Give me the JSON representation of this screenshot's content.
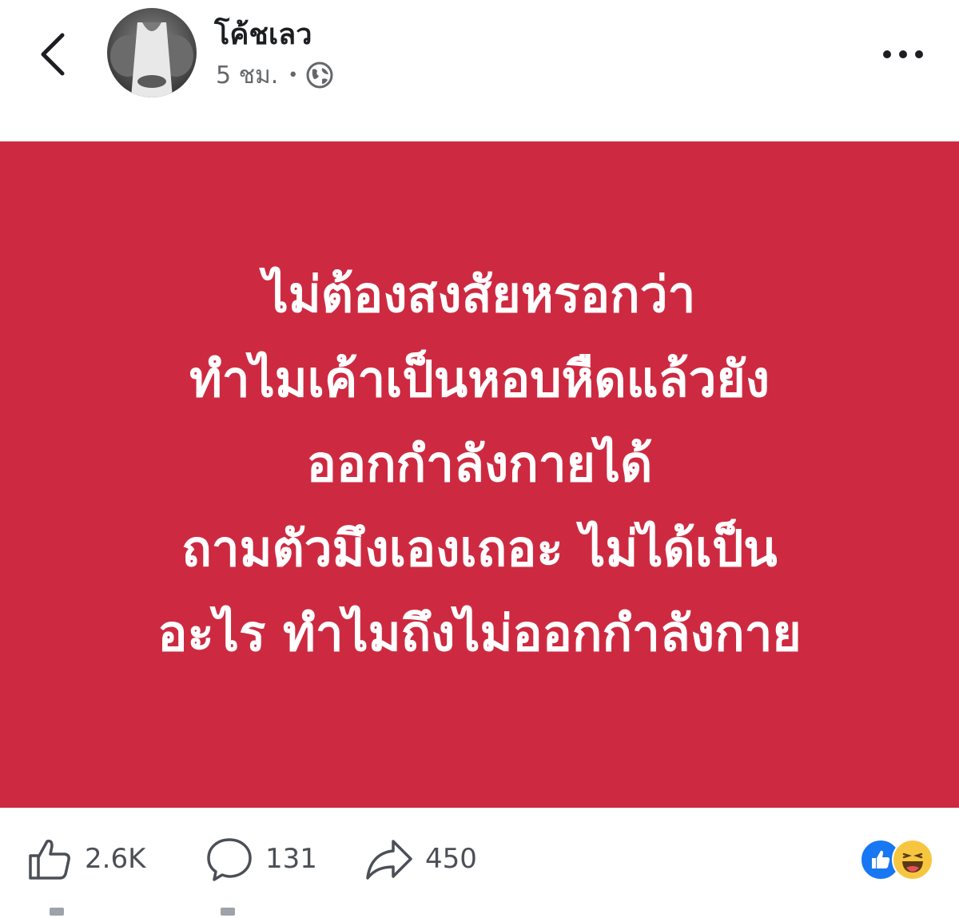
{
  "post": {
    "author": "โค้ชเลว",
    "time": "5 ชม.",
    "separator": "•",
    "privacy_icon": "globe-icon",
    "text_lines": [
      "ไม่ต้องสงสัยหรอกว่า",
      "ทำไมเค้าเป็นหอบหืดแล้วยัง",
      "ออกกำลังกายได้",
      "ถามตัวมึงเองเถอะ ไม่ได้เป็น",
      "อะไร ทำไมถึงไม่ออกกำลังกาย"
    ],
    "background_color": "#cd2a41"
  },
  "actions": {
    "likes": "2.6K",
    "comments": "131",
    "shares": "450"
  },
  "reactions": [
    "like-icon",
    "haha-icon"
  ],
  "colors": {
    "text_primary": "#1c1e21",
    "text_secondary": "#65676b",
    "like_blue": "#1877f2",
    "haha_yellow": "#f7c640"
  }
}
